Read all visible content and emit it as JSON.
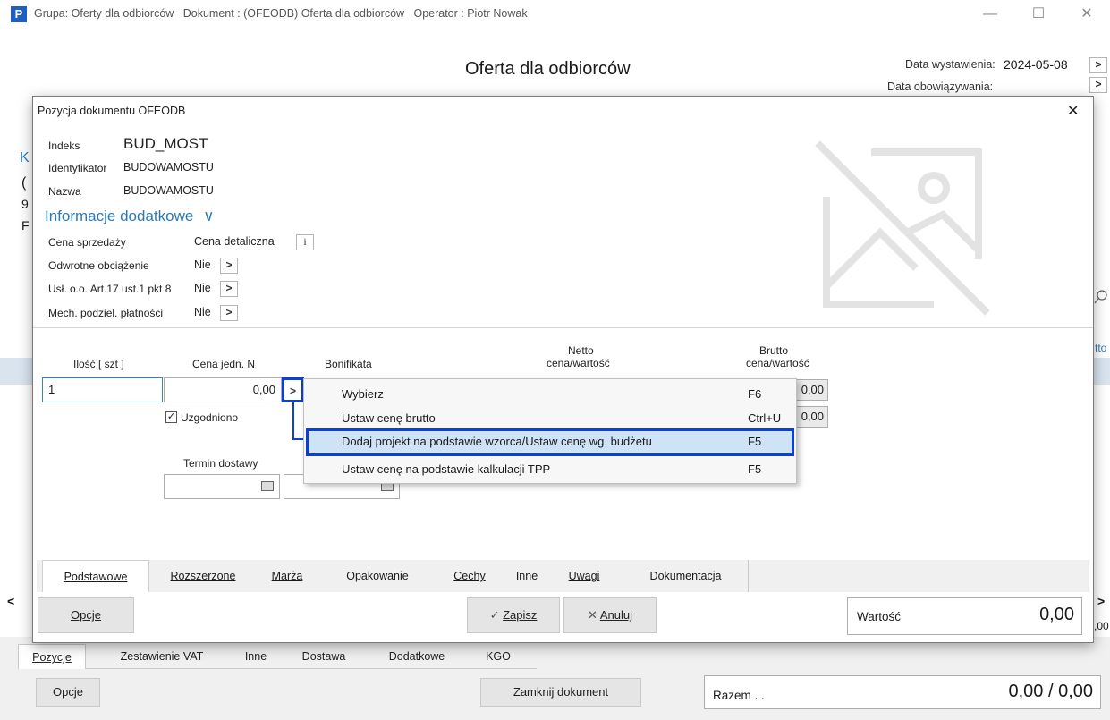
{
  "window": {
    "logo": "P",
    "title": "Grupa: Oferty dla odbiorców   Dokument : (OFEODB) Oferta dla odbiorców   Operator : Piotr Nowak",
    "minimize": "—",
    "maximize": "☐",
    "close": "✕"
  },
  "header": {
    "doc_title": "Oferta dla odbiorców",
    "issue_date_label": "Data wystawienia:",
    "issue_date_value": "2024-05-08",
    "valid_date_label": "Data obowiązywania:",
    "arrow": ">"
  },
  "background": {
    "left_letters": [
      "K",
      "(",
      "9",
      "F"
    ],
    "right_fragment": "tto",
    "scroll_left": "<",
    "scroll_right": ">",
    "right_value_fragment": ",00"
  },
  "dialog": {
    "title": "Pozycja dokumentu OFEODB",
    "close": "✕",
    "indeks_label": "Indeks",
    "indeks_value": "BUD_MOST",
    "identyfikator_label": "Identyfikator",
    "identyfikator_value": "BUDOWAMOSTU",
    "nazwa_label": "Nazwa",
    "nazwa_value": "BUDOWAMOSTU",
    "info_link": "Informacje dodatkowe",
    "info_chevron": "∨",
    "cena_sprzedazy_label": "Cena sprzedaży",
    "cena_sprzedazy_value": "Cena detaliczna",
    "info_icon": "i",
    "odwrotne_label": "Odwrotne obciążenie",
    "odwrotne_value": "Nie",
    "usl_label": "Usł. o.o. Art.17 ust.1 pkt 8",
    "usl_value": "Nie",
    "mech_label": "Mech. podziel. płatności",
    "mech_value": "Nie",
    "arrow": ">",
    "col_ilosc": "Ilość  [ szt ]",
    "col_cena": "Cena jedn. N",
    "col_bonifikata": "Bonifikata",
    "col_netto_1": "Netto",
    "col_netto_2": "cena/wartość",
    "col_brutto_1": "Brutto",
    "col_brutto_2": "cena/wartość",
    "ilosc_value": "1",
    "cena_value": "0,00",
    "brutto_cena": "0,00",
    "brutto_wartosc": "0,00",
    "uzgodniono_check": "✓",
    "uzgodniono_label": "Uzgodniono",
    "termin_label": "Termin dostawy",
    "tabs": [
      "Podstawowe",
      "Rozszerzone",
      "Marża",
      "Opakowanie",
      "Cechy",
      "Inne",
      "Uwagi",
      "Dokumentacja"
    ],
    "opcje_label": "Opcje",
    "zapisz_icon": "✓",
    "zapisz_label": "Zapisz",
    "anuluj_icon": "✕",
    "anuluj_label": "Anuluj",
    "wartosc_label": "Wartość",
    "wartosc_value": "0,00"
  },
  "context_menu": {
    "items": [
      {
        "label": "Wybierz",
        "shortcut": "F6"
      },
      {
        "label": "Ustaw cenę brutto",
        "shortcut": "Ctrl+U"
      },
      {
        "label": "Dodaj projekt na podstawie wzorca/Ustaw cenę wg. budżetu",
        "shortcut": "F5"
      },
      {
        "label": "Ustaw cenę na podstawie kalkulacji TPP",
        "shortcut": "F5"
      }
    ]
  },
  "footer": {
    "tabs": [
      "Pozycje",
      "Zestawienie VAT",
      "Inne",
      "Dostawa",
      "Dodatkowe",
      "KGO"
    ],
    "opcje_label": "Opcje",
    "zamknij_label": "Zamknij dokument",
    "razem_label": "Razem . .",
    "razem_value": "0,00 / 0,00"
  },
  "colors": {
    "highlight_border": "#0c3fd6",
    "highlight_fill": "#cfe3f7",
    "link": "#2a7ab8",
    "logo": "#1f5fbf"
  }
}
